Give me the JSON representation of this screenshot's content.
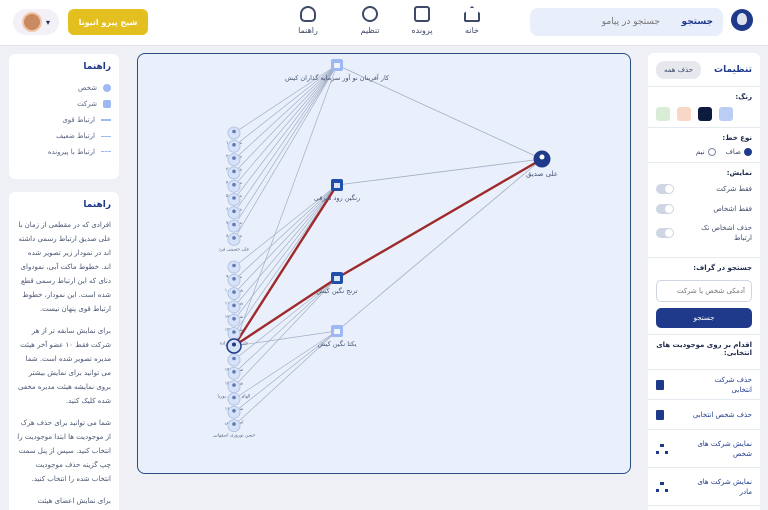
{
  "header": {
    "search_placeholder": "جستجو در پیامو",
    "search_button": "جستجو",
    "nav": [
      {
        "label": "خانه",
        "icon": "home-icon"
      },
      {
        "label": "پرونده",
        "icon": "card-icon"
      },
      {
        "label": "تنظیم",
        "icon": "gear-icon"
      },
      {
        "label": "راهنما",
        "icon": "bulb-icon"
      }
    ],
    "cta_label": "شیخ پیرو اتیونا",
    "user_caret": "▾"
  },
  "legend": {
    "title": "راهنما",
    "items": [
      "شخص",
      "شرکت",
      "ارتباط قوی",
      "ارتباط ضعیف",
      "ارتباط با پیرونده"
    ]
  },
  "guide": {
    "title": "راهنما",
    "paragraphs": [
      "افرادی که در مقطعی از زمان با علی صدیق ارتباط رسمی داشته اند در نمودار زیر تصویر شده اند. خطوط ماکت آبی، نمودوای دنای که این ارتباط رسمی قطع شده است. این نمودار، خطوط ارتباط قوی پنهان نیست.",
      "برای نمایش سابقه تر از هر شرکت فقط ۱۰ عضو آخر هیئت مدیره تصویر شده است. شما می توانید برای نمایش بیشتر بروی نمایشه هیئت مدیره مخفی شده کلیک کنید.",
      "شما می توانید برای حذف هرک از موجودیت ها ابتدا موجودیت را انتخاب کنید. سپس از پنل سمت چپ گزینه حذف موجودیت انتخاب شده را انتخاب کنید.",
      "برای نمایش اعضای هیئت مدیره، شرکت های مادر و"
    ]
  },
  "graph": {
    "center": {
      "label": "علی صدیق"
    },
    "companies": [
      {
        "label": "کار آفرینان نو آور سرمایه گذاران کیش"
      },
      {
        "label": "رنگین رود شرقی"
      },
      {
        "label": "ترنج نگین کیش"
      },
      {
        "label": "یکتا نگین کیش"
      }
    ],
    "person_labels_a": [
      "شخص ۱",
      "شخص ۲",
      "شخص ۳",
      "شخص ۴",
      "شخص ۵",
      "شخص ۶",
      "شخص ۷",
      "شخص ۸",
      "علی حسینی فرد"
    ],
    "person_labels_b": [
      "شخص ۹",
      "شخص ۱۰",
      "شخص ۱۱",
      "شخص ۱۲",
      "شخص ۱۳",
      "علی حسن زاده"
    ],
    "person_labels_c": [
      "شخص ۱۴",
      "شخص ۱۵",
      "الهام شاملی پوریا"
    ],
    "person_labels_d": [
      "شخص ۱۶",
      "امیرحسین",
      "حسن نوروزی اصفهانی"
    ]
  },
  "settings": {
    "title": "تنظیمات",
    "reset_button": "حذف همه",
    "color_label": "رنگ:",
    "colors": [
      "#b9cdf5",
      "#0d1b3e",
      "#f8d7c8",
      "#d8ecd6"
    ],
    "line_type_label": "نوع خط:",
    "line_types": [
      "صاف",
      "نیم"
    ],
    "show_label": "نمایش:",
    "toggles": [
      "فقط شرکت",
      "فقط اشخاص",
      "حذف اشخاص تک ارتباط"
    ],
    "graph_search_label": "جستجو در گراف:",
    "graph_search_placeholder": "آدمکی شخص یا شرکت",
    "graph_search_button": "جستجو",
    "actions_title": "اقدام بر روی موجودیت های انتخابی:",
    "actions": [
      "حذف شرکت انتخابی",
      "حذف شخص انتخابی",
      "نمایش شرکت های شخص",
      "نمایش شرکت های مادر"
    ]
  }
}
